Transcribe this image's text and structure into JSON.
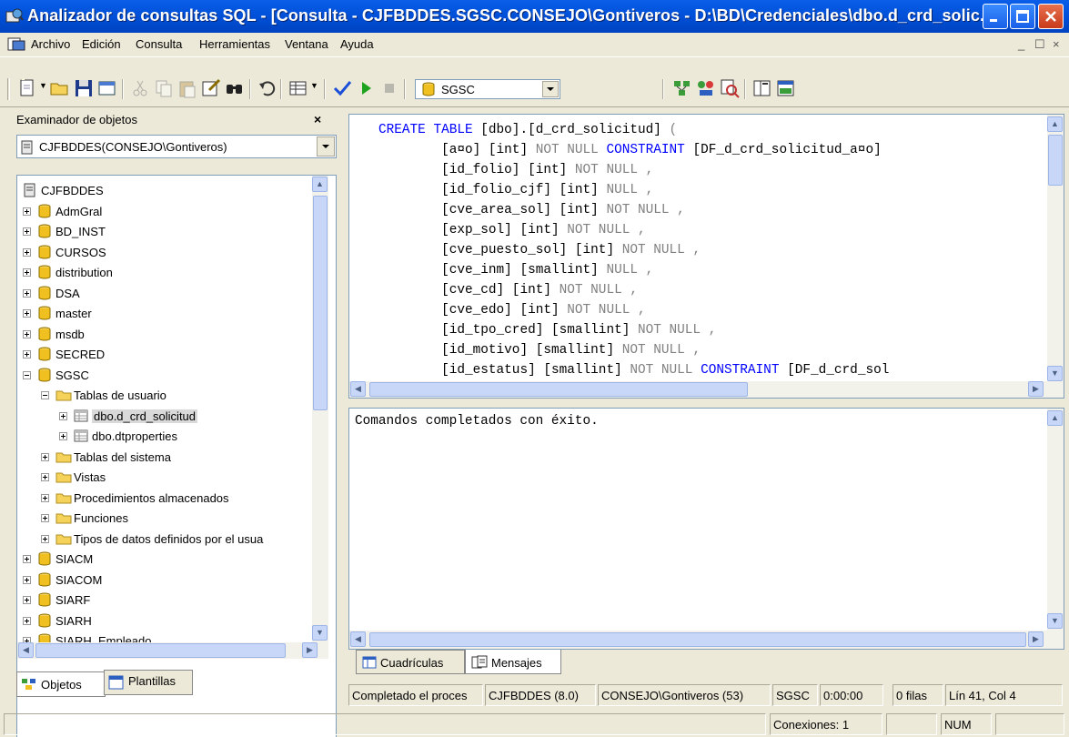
{
  "window": {
    "title": "Analizador de consultas SQL - [Consulta - CJFBDDES.SGSC.CONSEJO\\Gontiveros - D:\\BD\\Credenciales\\dbo.d_crd_solic..."
  },
  "menu": [
    "Archivo",
    "Edición",
    "Consulta",
    "Herramientas",
    "Ventana",
    "Ayuda"
  ],
  "mdi_controls": [
    "_",
    "☐",
    "×"
  ],
  "toolbar": {
    "database": "SGSC"
  },
  "object_browser": {
    "title": "Examinador de objetos",
    "close": "×",
    "server": "CJFBDDES(CONSEJO\\Gontiveros)",
    "tree": [
      {
        "label": "CJFBDDES",
        "level": 0,
        "icon": "server-icon",
        "exp": "none"
      },
      {
        "label": "AdmGral",
        "level": 0,
        "icon": "database-icon",
        "exp": "plus"
      },
      {
        "label": "BD_INST",
        "level": 0,
        "icon": "database-icon",
        "exp": "plus"
      },
      {
        "label": "CURSOS",
        "level": 0,
        "icon": "database-icon",
        "exp": "plus"
      },
      {
        "label": "distribution",
        "level": 0,
        "icon": "database-icon",
        "exp": "plus"
      },
      {
        "label": "DSA",
        "level": 0,
        "icon": "database-icon",
        "exp": "plus"
      },
      {
        "label": "master",
        "level": 0,
        "icon": "database-icon",
        "exp": "plus"
      },
      {
        "label": "msdb",
        "level": 0,
        "icon": "database-icon",
        "exp": "plus"
      },
      {
        "label": "SECRED",
        "level": 0,
        "icon": "database-icon",
        "exp": "plus"
      },
      {
        "label": "SGSC",
        "level": 0,
        "icon": "database-icon",
        "exp": "minus"
      },
      {
        "label": "Tablas de usuario",
        "level": 1,
        "icon": "folder-icon",
        "exp": "minus"
      },
      {
        "label": "dbo.d_crd_solicitud",
        "level": 2,
        "icon": "table-icon",
        "exp": "plus",
        "selected": true
      },
      {
        "label": "dbo.dtproperties",
        "level": 2,
        "icon": "table-icon",
        "exp": "plus"
      },
      {
        "label": "Tablas del sistema",
        "level": 1,
        "icon": "folder-icon",
        "exp": "plus"
      },
      {
        "label": "Vistas",
        "level": 1,
        "icon": "folder-icon",
        "exp": "plus"
      },
      {
        "label": "Procedimientos almacenados",
        "level": 1,
        "icon": "folder-icon",
        "exp": "plus"
      },
      {
        "label": "Funciones",
        "level": 1,
        "icon": "folder-icon",
        "exp": "plus"
      },
      {
        "label": "Tipos de datos definidos por el usua",
        "level": 1,
        "icon": "folder-icon",
        "exp": "plus"
      },
      {
        "label": "SIACM",
        "level": 0,
        "icon": "database-icon",
        "exp": "plus"
      },
      {
        "label": "SIACOM",
        "level": 0,
        "icon": "database-icon",
        "exp": "plus"
      },
      {
        "label": "SIARF",
        "level": 0,
        "icon": "database-icon",
        "exp": "plus"
      },
      {
        "label": "SIARH",
        "level": 0,
        "icon": "database-icon",
        "exp": "plus"
      },
      {
        "label": "SIARH_Empleado",
        "level": 0,
        "icon": "database-icon",
        "exp": "plus"
      }
    ],
    "tabs": [
      "Objetos",
      "Plantillas"
    ]
  },
  "editor": {
    "lines": [
      [
        {
          "t": "CREATE TABLE ",
          "c": "kw"
        },
        {
          "t": "[dbo].[d_crd_solicitud] ",
          "c": ""
        },
        {
          "t": "(",
          "c": "gr"
        }
      ],
      [
        {
          "t": "        [a¤o] [int] ",
          "c": ""
        },
        {
          "t": "NOT NULL ",
          "c": "gr"
        },
        {
          "t": "CONSTRAINT ",
          "c": "kw"
        },
        {
          "t": "[DF_d_crd_solicitud_a¤o]",
          "c": ""
        }
      ],
      [
        {
          "t": "        [id_folio] [int] ",
          "c": ""
        },
        {
          "t": "NOT NULL ,",
          "c": "gr"
        }
      ],
      [
        {
          "t": "        [id_folio_cjf] [int] ",
          "c": ""
        },
        {
          "t": "NULL ,",
          "c": "gr"
        }
      ],
      [
        {
          "t": "        [cve_area_sol] [int] ",
          "c": ""
        },
        {
          "t": "NOT NULL ,",
          "c": "gr"
        }
      ],
      [
        {
          "t": "        [exp_sol] [int] ",
          "c": ""
        },
        {
          "t": "NOT NULL ,",
          "c": "gr"
        }
      ],
      [
        {
          "t": "        [cve_puesto_sol] [int] ",
          "c": ""
        },
        {
          "t": "NOT NULL ,",
          "c": "gr"
        }
      ],
      [
        {
          "t": "        [cve_inm] [smallint] ",
          "c": ""
        },
        {
          "t": "NULL ,",
          "c": "gr"
        }
      ],
      [
        {
          "t": "        [cve_cd] [int] ",
          "c": ""
        },
        {
          "t": "NOT NULL ,",
          "c": "gr"
        }
      ],
      [
        {
          "t": "        [cve_edo] [int] ",
          "c": ""
        },
        {
          "t": "NOT NULL ,",
          "c": "gr"
        }
      ],
      [
        {
          "t": "        [id_tpo_cred] [smallint] ",
          "c": ""
        },
        {
          "t": "NOT NULL ,",
          "c": "gr"
        }
      ],
      [
        {
          "t": "        [id_motivo] [smallint] ",
          "c": ""
        },
        {
          "t": "NOT NULL ,",
          "c": "gr"
        }
      ],
      [
        {
          "t": "        [id_estatus] [smallint] ",
          "c": ""
        },
        {
          "t": "NOT NULL ",
          "c": "gr"
        },
        {
          "t": "CONSTRAINT ",
          "c": "kw"
        },
        {
          "t": "[DF_d_crd_sol",
          "c": ""
        }
      ]
    ]
  },
  "results": {
    "message": "Comandos completados con éxito.",
    "tabs": [
      "Cuadrículas",
      "Mensajes"
    ]
  },
  "status": {
    "cells": [
      "Completado el proces",
      "CJFBDDES (8.0)",
      "CONSEJO\\Gontiveros (53)",
      "SGSC",
      "0:00:00",
      "0 filas",
      "Lín 41, Col 4"
    ],
    "connections": "Conexiones: 1",
    "num": "NUM"
  },
  "colors": {
    "titlebar": "#0050d8",
    "keyword": "#0000ff",
    "comment_gray": "#808080",
    "folder": "#f5d35b",
    "database": "#f0c020"
  }
}
